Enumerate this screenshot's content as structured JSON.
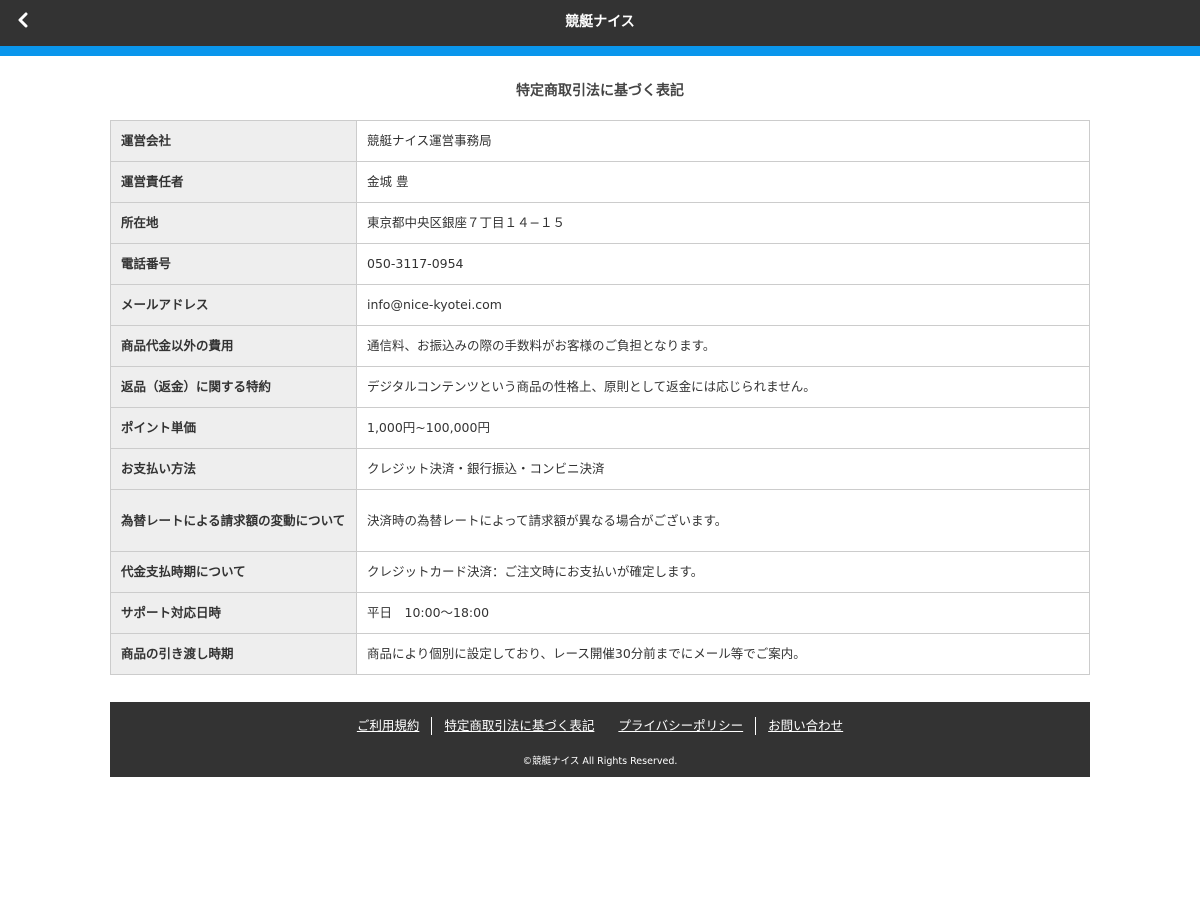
{
  "header": {
    "title": "競艇ナイス",
    "back_icon": "chevron-left-icon"
  },
  "colors": {
    "header_bg": "#333333",
    "accent": "#0a96ec",
    "label_bg": "#eeeeee",
    "border": "#cccccc"
  },
  "page": {
    "title": "特定商取引法に基づく表記"
  },
  "table": {
    "rows": [
      {
        "label": "運営会社",
        "value": "競艇ナイス運営事務局"
      },
      {
        "label": "運営責任者",
        "value": "金城 豊"
      },
      {
        "label": "所在地",
        "value": "東京都中央区銀座７丁目１４−１５"
      },
      {
        "label": "電話番号",
        "value": "050-3117-0954"
      },
      {
        "label": "メールアドレス",
        "value": "info@nice-kyotei.com"
      },
      {
        "label": "商品代金以外の費用",
        "value": "通信料、お振込みの際の手数料がお客様のご負担となります。"
      },
      {
        "label": "返品（返金）に関する特約",
        "value": "デジタルコンテンツという商品の性格上、原則として返金には応じられません。"
      },
      {
        "label": "ポイント単価",
        "value": "1,000円~100,000円"
      },
      {
        "label": "お支払い方法",
        "value": "クレジット決済・銀行振込・コンビニ決済"
      },
      {
        "label": "為替レートによる請求額の変動について",
        "value": "決済時の為替レートによって請求額が異なる場合がございます。"
      },
      {
        "label": "代金支払時期について",
        "value": "クレジットカード決済：ご注文時にお支払いが確定します。"
      },
      {
        "label": "サポート対応日時",
        "value": "平日　10:00〜18:00"
      },
      {
        "label": "商品の引き渡し時期",
        "value": "商品により個別に設定しており、レース開催30分前までにメール等でご案内。"
      }
    ]
  },
  "footer": {
    "links": {
      "terms": "ご利用規約",
      "tokusho": "特定商取引法に基づく表記",
      "privacy": "プライバシーポリシー",
      "contact": "お問い合わせ"
    },
    "copyright": "©競艇ナイス All Rights Reserved."
  }
}
